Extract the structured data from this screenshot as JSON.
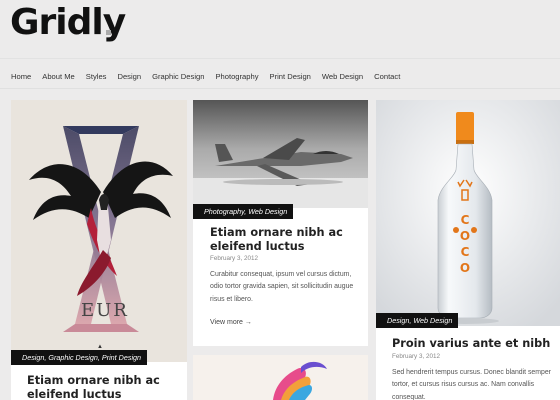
{
  "site": {
    "logo": "Gridly"
  },
  "nav": [
    "Home",
    "About Me",
    "Styles",
    "Design",
    "Graphic Design",
    "Photography",
    "Print Design",
    "Web Design",
    "Contact"
  ],
  "cards": [
    {
      "tag": "Design, Graphic Design, Print Design",
      "title": "Etiam ornare nibh ac eleifend luctus",
      "image_text": "EUR"
    },
    {
      "tag": "Photography, Web Design",
      "title": "Etiam ornare nibh ac eleifend luctus",
      "date": "February 3, 2012",
      "excerpt": "Curabitur consequat, ipsum vel cursus dictum, odio tortor gravida sapien, sit sollicitudin augue risus et libero.",
      "more": "View more →"
    },
    {
      "tag": "Design, Web Design",
      "title": "Proin varius ante et nibh",
      "date": "February 3, 2012",
      "excerpt": "Sed hendrerit tempus cursus. Donec blandit semper tortor, et cursus risus cursus ac. Nam convallis consequat.",
      "image_text": "COCO"
    }
  ],
  "colors": {
    "background": "#ecebeb",
    "tag_bg": "#111111",
    "bottle_cap": "#f08a1c"
  }
}
